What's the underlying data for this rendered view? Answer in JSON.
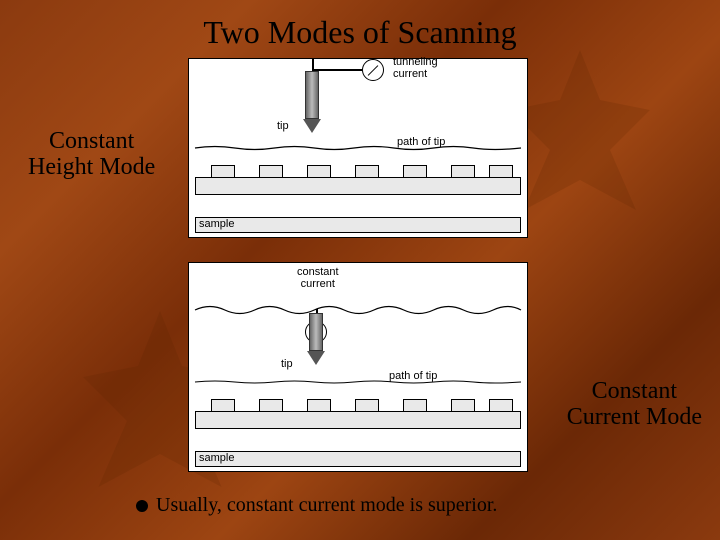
{
  "title": "Two Modes of Scanning",
  "labels": {
    "left_mode_line1": "Constant",
    "left_mode_line2": "Height Mode",
    "right_mode_line1": "Constant",
    "right_mode_line2": "Current Mode"
  },
  "bullet": {
    "text": "Usually, constant current mode is superior."
  },
  "panels": {
    "top": {
      "tip_label": "tip",
      "meter_label_line1": "tunneling",
      "meter_label_line2": "current",
      "path_label": "path of tip",
      "sample_label": "sample"
    },
    "bottom": {
      "tip_label": "tip",
      "meter_label_line1": "constant",
      "meter_label_line2": "current",
      "path_label": "path of tip",
      "sample_label": "sample"
    }
  },
  "icons": {
    "meter": "current-meter-icon",
    "tip": "probe-tip-icon",
    "bullet": "bullet-icon"
  }
}
